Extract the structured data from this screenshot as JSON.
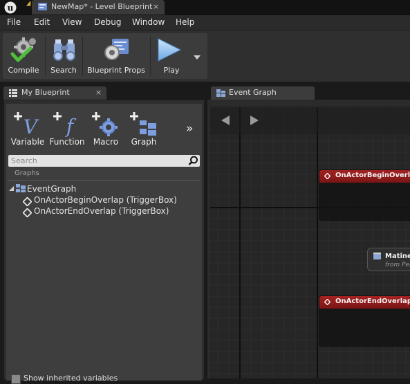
{
  "window": {
    "tab_title": "NewMap* - Level Blueprint",
    "tab_close": "×"
  },
  "menu": [
    "File",
    "Edit",
    "View",
    "Debug",
    "Window",
    "Help"
  ],
  "toolbar": {
    "compile_label": "Compile",
    "search_label": "Search",
    "blueprint_props_label": "Blueprint Props",
    "play_label": "Play"
  },
  "my_blueprint": {
    "tab_title": "My Blueprint",
    "tab_close": "×",
    "add_buttons": {
      "variable": "Variable",
      "function": "Function",
      "macro": "Macro",
      "graph": "Graph"
    },
    "more": "»",
    "search_placeholder": "Search",
    "graphs_label": "Graphs",
    "tree": {
      "root": "EventGraph",
      "children": [
        "OnActorBeginOverlap (TriggerBox)",
        "OnActorEndOverlap (TriggerBox)"
      ]
    },
    "show_inherited": "Show inherited variables"
  },
  "event_graph": {
    "tab_title": "Event Graph",
    "nodes": {
      "begin_overlap": "OnActorBeginOverlap",
      "end_overlap": "OnActorEndOverlap (T",
      "matinee_title": "Matinee",
      "matinee_sub": "from Per"
    }
  },
  "colors": {
    "event_node_header": "#a52222",
    "play_accent": "#6aa7e0",
    "compile_check": "#4fbf3a"
  }
}
